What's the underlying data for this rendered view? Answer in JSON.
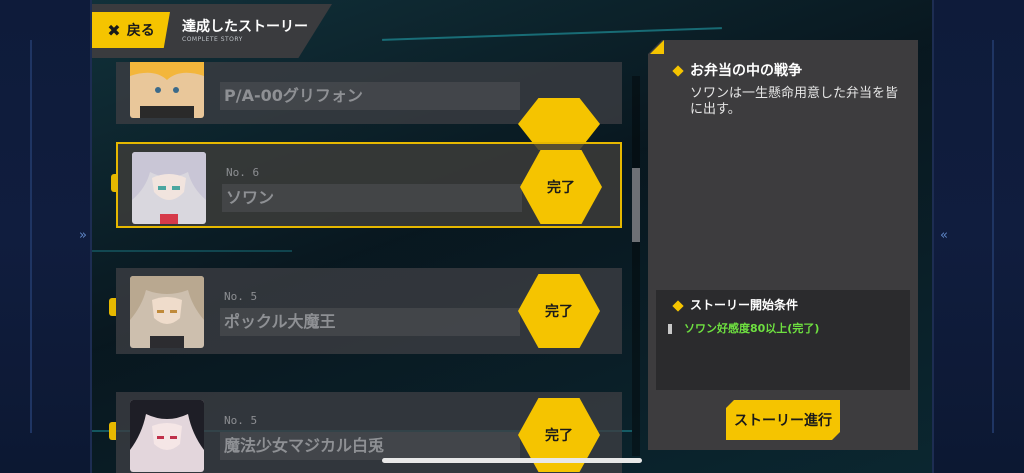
{
  "header": {
    "back_label": "戻る",
    "title": "達成したストーリー",
    "subtitle": "COMPLETE STORY"
  },
  "stories": [
    {
      "no": "",
      "name": "P/A-00グリフォン",
      "status": ""
    },
    {
      "no": "No. 6",
      "name": "ソワン",
      "status": "完了"
    },
    {
      "no": "No. 5",
      "name": "ポックル大魔王",
      "status": "完了"
    },
    {
      "no": "No. 5",
      "name": "魔法少女マジカル白兎",
      "status": "完了"
    }
  ],
  "detail": {
    "title": "お弁当の中の戦争",
    "description": "ソワンは一生懸命用意した弁当を皆に出す。",
    "condition_heading": "ストーリー開始条件",
    "condition_item": "ソワン好感度80以上(完了)",
    "proceed_label": "ストーリー進行"
  },
  "colors": {
    "accent": "#f5c400",
    "condition_met": "#6ee040"
  }
}
